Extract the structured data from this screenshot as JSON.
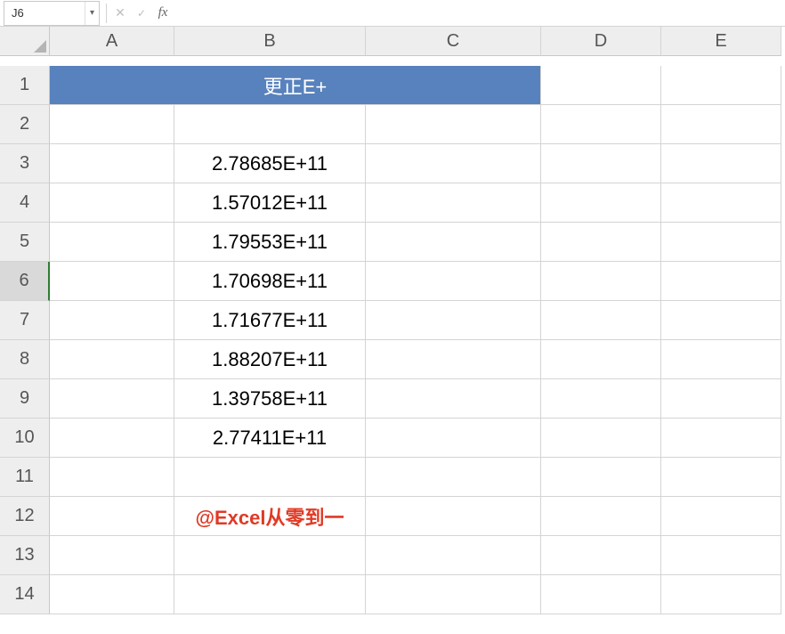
{
  "nameBox": {
    "ref": "J6"
  },
  "formula": {
    "value": ""
  },
  "columns": [
    "A",
    "B",
    "C",
    "D",
    "E"
  ],
  "rows": [
    "1",
    "2",
    "3",
    "4",
    "5",
    "6",
    "7",
    "8",
    "9",
    "10",
    "11",
    "12",
    "13",
    "14"
  ],
  "selectedRow": "6",
  "mergedHeader": {
    "text": "更正E+"
  },
  "dataValues": [
    "2.78685E+11",
    "1.57012E+11",
    "1.79553E+11",
    "1.70698E+11",
    "1.71677E+11",
    "1.88207E+11",
    "1.39758E+11",
    "2.77411E+11"
  ],
  "watermark": {
    "text": "@Excel从零到一"
  },
  "icons": {
    "dropdown": "▾",
    "cancel": "✕",
    "accept": "✓",
    "fx": "fx"
  }
}
